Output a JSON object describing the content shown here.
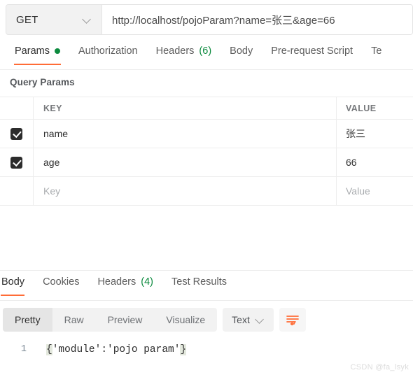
{
  "request": {
    "method": "GET",
    "method_icon": "chevron-down-icon",
    "url": "http://localhost/pojoParam?name=张三&age=66",
    "url_placeholder": "Enter request URL"
  },
  "request_tabs": [
    {
      "label": "Params",
      "active": true,
      "indicator": "green-dot"
    },
    {
      "label": "Authorization",
      "active": false
    },
    {
      "label": "Headers",
      "active": false,
      "count": "(6)"
    },
    {
      "label": "Body",
      "active": false
    },
    {
      "label": "Pre-request Script",
      "active": false
    },
    {
      "label": "Te",
      "active": false
    }
  ],
  "query_params": {
    "title": "Query Params",
    "columns": {
      "key": "KEY",
      "value": "VALUE"
    },
    "rows": [
      {
        "checked": true,
        "key": "name",
        "value": "张三"
      },
      {
        "checked": true,
        "key": "age",
        "value": "66"
      },
      {
        "checked": false,
        "key": "",
        "value": "",
        "key_placeholder": "Key",
        "value_placeholder": "Value"
      }
    ]
  },
  "response_tabs": [
    {
      "label": "Body",
      "active": true
    },
    {
      "label": "Cookies",
      "active": false
    },
    {
      "label": "Headers",
      "active": false,
      "count": "(4)"
    },
    {
      "label": "Test Results",
      "active": false
    }
  ],
  "response_toolbar": {
    "views": [
      {
        "label": "Pretty",
        "active": true
      },
      {
        "label": "Raw",
        "active": false
      },
      {
        "label": "Preview",
        "active": false
      },
      {
        "label": "Visualize",
        "active": false
      }
    ],
    "format": "Text",
    "format_icon": "chevron-down-icon",
    "wrap_icon": "word-wrap-icon",
    "wrap_color": "#ff6c37"
  },
  "response_body": {
    "line_number": "1",
    "open_brace": "{",
    "content": "'module':'pojo param'",
    "close_brace": "}"
  },
  "watermark": "CSDN @fa_lsyk",
  "colors": {
    "accent": "#ff6c37",
    "green": "#0c8a3e",
    "border": "#ededed",
    "panel": "#f2f2f2"
  }
}
